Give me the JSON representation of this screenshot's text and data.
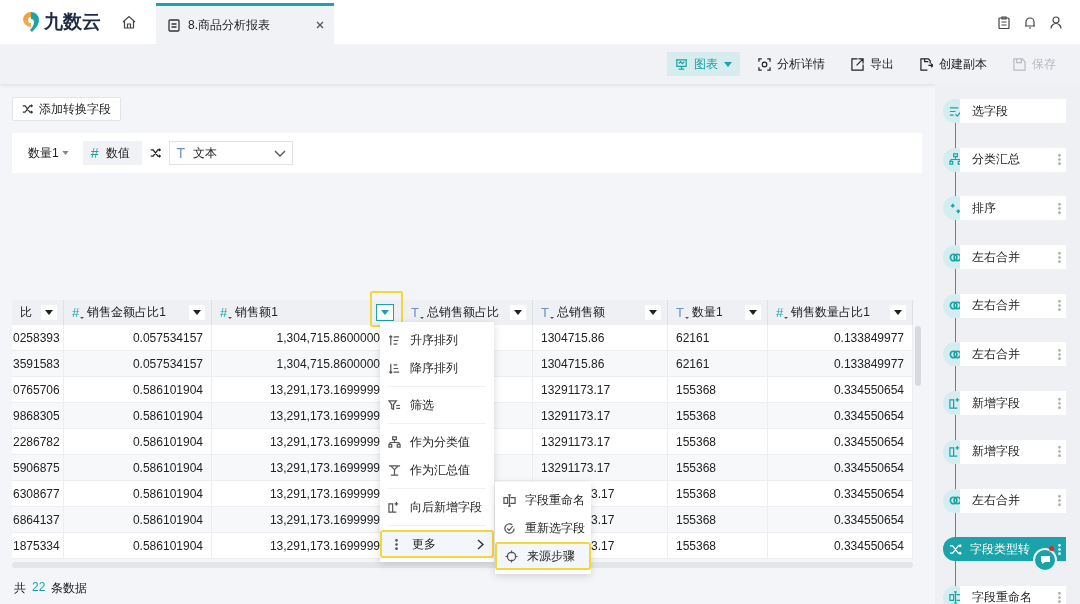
{
  "app": {
    "name": "九数云"
  },
  "tabs": [
    {
      "label": "8.商品分析报表",
      "selected": true
    }
  ],
  "toolbar": [
    {
      "label": "图表",
      "kind": "chart",
      "active": true,
      "disabled": false
    },
    {
      "label": "分析详情",
      "kind": "details",
      "active": false,
      "disabled": false
    },
    {
      "label": "导出",
      "kind": "export",
      "active": false,
      "disabled": false
    },
    {
      "label": "创建副本",
      "kind": "copy",
      "active": false,
      "disabled": false
    },
    {
      "label": "保存",
      "kind": "save",
      "active": false,
      "disabled": true
    }
  ],
  "add_button": "添加转换字段",
  "transform": {
    "field": "数量1",
    "from_mark": "#",
    "from_type": "数值",
    "to_mark": "T",
    "to_type": "文本"
  },
  "table": {
    "columns": [
      {
        "title": "比",
        "menu_open": false
      },
      {
        "title": "销售金额占比1",
        "kind": "number",
        "type_mark": "#",
        "menu_open": false
      },
      {
        "title": "销售额1",
        "kind": "number",
        "type_mark": "#",
        "menu_open": true
      },
      {
        "title": "总销售额占比",
        "kind": "text",
        "type_mark": "T",
        "menu_open": false
      },
      {
        "title": "总销售额",
        "kind": "text",
        "type_mark": "T",
        "menu_open": false
      },
      {
        "title": "数量1",
        "kind": "text",
        "type_mark": "T",
        "menu_open": false
      },
      {
        "title": "销售数量占比1",
        "kind": "number",
        "type_mark": "#",
        "menu_open": false
      }
    ],
    "rows": [
      [
        "0258393",
        "0.057534157",
        "1,304,715.8600000",
        null,
        "1304715.86",
        "62161",
        "0.133849977"
      ],
      [
        "3591583",
        "0.057534157",
        "1,304,715.8600000",
        null,
        "1304715.86",
        "62161",
        "0.133849977"
      ],
      [
        "0765706",
        "0.586101904",
        "13,291,173.1699999",
        null,
        "13291173.17",
        "155368",
        "0.334550654"
      ],
      [
        "9868305",
        "0.586101904",
        "13,291,173.1699999",
        null,
        "13291173.17",
        "155368",
        "0.334550654"
      ],
      [
        "2286782",
        "0.586101904",
        "13,291,173.1699999",
        null,
        "13291173.17",
        "155368",
        "0.334550654"
      ],
      [
        "5906875",
        "0.586101904",
        "13,291,173.1699999",
        null,
        "13291173.17",
        "155368",
        "0.334550654"
      ],
      [
        "6308677",
        "0.586101904",
        "13,291,173.1699999",
        null,
        "3.17",
        "155368",
        "0.334550654"
      ],
      [
        "6864137",
        "0.586101904",
        "13,291,173.1699999",
        null,
        "3.17",
        "155368",
        "0.334550654"
      ],
      [
        "1875334",
        "0.586101904",
        "13,291,173.1699999",
        null,
        "3.17",
        "155368",
        "0.334550654"
      ]
    ]
  },
  "column_menu": [
    {
      "label": "升序排列",
      "kind": "asc",
      "highlighted": false,
      "submenu": false
    },
    {
      "label": "降序排列",
      "kind": "desc",
      "highlighted": false,
      "submenu": false
    },
    {
      "label": "筛选",
      "kind": "filter",
      "highlighted": false,
      "submenu": false
    },
    {
      "label": "作为分类值",
      "kind": "group",
      "highlighted": false,
      "submenu": false
    },
    {
      "label": "作为汇总值",
      "kind": "sum",
      "highlighted": false,
      "submenu": false
    },
    {
      "label": "向后新增字段",
      "kind": "add",
      "highlighted": false,
      "submenu": false
    },
    {
      "label": "更多",
      "kind": "more",
      "highlighted": true,
      "submenu": true
    }
  ],
  "submenu": [
    {
      "label": "字段重命名",
      "kind": "rename",
      "highlighted": false
    },
    {
      "label": "重新选字段",
      "kind": "reselect",
      "highlighted": false
    },
    {
      "label": "来源步骤",
      "kind": "source",
      "highlighted": true
    }
  ],
  "footer": {
    "prefix": "共",
    "count": "22",
    "suffix": "条数据"
  },
  "steps": [
    {
      "label": "选字段",
      "kind": "select",
      "selected": false,
      "has_menu": false
    },
    {
      "label": "分类汇总",
      "kind": "group",
      "selected": false,
      "has_menu": true
    },
    {
      "label": "排序",
      "kind": "sort",
      "selected": false,
      "has_menu": true
    },
    {
      "label": "左右合并",
      "kind": "merge",
      "selected": false,
      "has_menu": true
    },
    {
      "label": "左右合并",
      "kind": "merge",
      "selected": false,
      "has_menu": true
    },
    {
      "label": "左右合并",
      "kind": "merge",
      "selected": false,
      "has_menu": true
    },
    {
      "label": "新增字段",
      "kind": "add",
      "selected": false,
      "has_menu": true
    },
    {
      "label": "新增字段",
      "kind": "add",
      "selected": false,
      "has_menu": true
    },
    {
      "label": "左右合并",
      "kind": "merge",
      "selected": false,
      "has_menu": true
    },
    {
      "label": "字段类型转",
      "kind": "convert",
      "selected": true,
      "has_menu": true
    },
    {
      "label": "字段重命名",
      "kind": "rename",
      "selected": false,
      "has_menu": true
    }
  ],
  "chat": {
    "unread": true
  }
}
